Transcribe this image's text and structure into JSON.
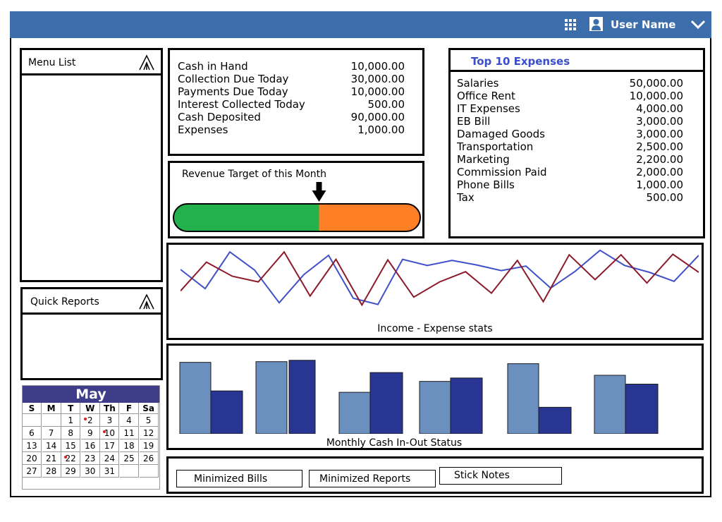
{
  "header": {
    "user_name": "User Name"
  },
  "menu_list": {
    "title": "Menu List"
  },
  "quick_reports": {
    "title": "Quick Reports"
  },
  "cash_summary": {
    "rows": [
      {
        "label": "Cash in Hand",
        "value": "10,000.00"
      },
      {
        "label": "Collection Due Today",
        "value": "30,000.00"
      },
      {
        "label": "Payments Due Today",
        "value": "10,000.00"
      },
      {
        "label": "Interest Collected Today",
        "value": "500.00"
      },
      {
        "label": "Cash Deposited",
        "value": "90,000.00"
      },
      {
        "label": "Expenses",
        "value": "1,000.00"
      }
    ]
  },
  "revenue_target": {
    "title": "Revenue Target of this Month",
    "progress": 0.59,
    "done_color": "#22b14c",
    "remaining_color": "#ff7f27"
  },
  "top_expenses": {
    "title": "Top 10 Expenses",
    "rows": [
      {
        "label": "Salaries",
        "value": "50,000.00"
      },
      {
        "label": "Office Rent",
        "value": "10,000.00"
      },
      {
        "label": "IT Expenses",
        "value": "4,000.00"
      },
      {
        "label": "EB Bill",
        "value": "3,000.00"
      },
      {
        "label": "Damaged Goods",
        "value": "3,000.00"
      },
      {
        "label": "Transportation",
        "value": "2,500.00"
      },
      {
        "label": "Marketing",
        "value": "2,200.00"
      },
      {
        "label": "Commission Paid",
        "value": "2,000.00"
      },
      {
        "label": "Phone Bills",
        "value": "1,000.00"
      },
      {
        "label": "Tax",
        "value": "500.00"
      }
    ]
  },
  "chart_data": [
    {
      "type": "line",
      "title": "Income - Expense stats",
      "x": [
        1,
        2,
        3,
        4,
        5,
        6,
        7,
        8,
        9,
        10,
        11,
        12,
        13,
        14,
        15,
        16,
        17,
        18,
        19,
        20
      ],
      "ylim": [
        0,
        10
      ],
      "series": [
        {
          "color": "#4050c8",
          "values": [
            6.5,
            3.1,
            9.6,
            6.4,
            0.6,
            5.6,
            9.0,
            1.4,
            0.3,
            8.3,
            7.2,
            8.1,
            7.3,
            6.3,
            7.1,
            3.2,
            6.2,
            9.9,
            7.2,
            6.0,
            4.4,
            9.0
          ]
        },
        {
          "color": "#8b1a2a",
          "values": [
            2.7,
            7.8,
            5.3,
            4.3,
            9.6,
            1.8,
            8.3,
            0.2,
            8.2,
            1.6,
            4.3,
            6.1,
            2.3,
            8.1,
            0.8,
            9.1,
            4.7,
            9.1,
            4.1,
            9.2,
            6.0
          ]
        }
      ]
    },
    {
      "type": "bar",
      "title": "Monthly Cash In-Out Status",
      "categories": [
        "",
        "",
        "",
        "",
        "",
        ""
      ],
      "ylim": [
        0,
        115
      ],
      "series": [
        {
          "color": "#6b90c0",
          "values": [
            105,
            106,
            61,
            77,
            103,
            86
          ]
        },
        {
          "color": "#283593",
          "values": [
            63,
            108,
            90,
            82,
            39,
            73
          ]
        }
      ]
    }
  ],
  "calendar": {
    "month": "May",
    "weekdays": [
      "S",
      "M",
      "T",
      "W",
      "Th",
      "F",
      "Sa"
    ],
    "weeks": [
      [
        "",
        "",
        "1",
        "2",
        "3",
        "4",
        "5"
      ],
      [
        "6",
        "7",
        "8",
        "9",
        "10",
        "11",
        "12"
      ],
      [
        "13",
        "14",
        "15",
        "16",
        "17",
        "18",
        "19"
      ],
      [
        "20",
        "21",
        "22",
        "23",
        "24",
        "25",
        "26"
      ],
      [
        "27",
        "28",
        "29",
        "30",
        "31",
        "",
        ""
      ]
    ],
    "marked_days": [
      "2",
      "10",
      "22"
    ],
    "header_color": "#3d3d8a"
  },
  "taskbar": {
    "buttons": [
      {
        "label": "Minimized Bills"
      },
      {
        "label": "Minimized Reports"
      },
      {
        "label": "Stick Notes"
      }
    ]
  }
}
